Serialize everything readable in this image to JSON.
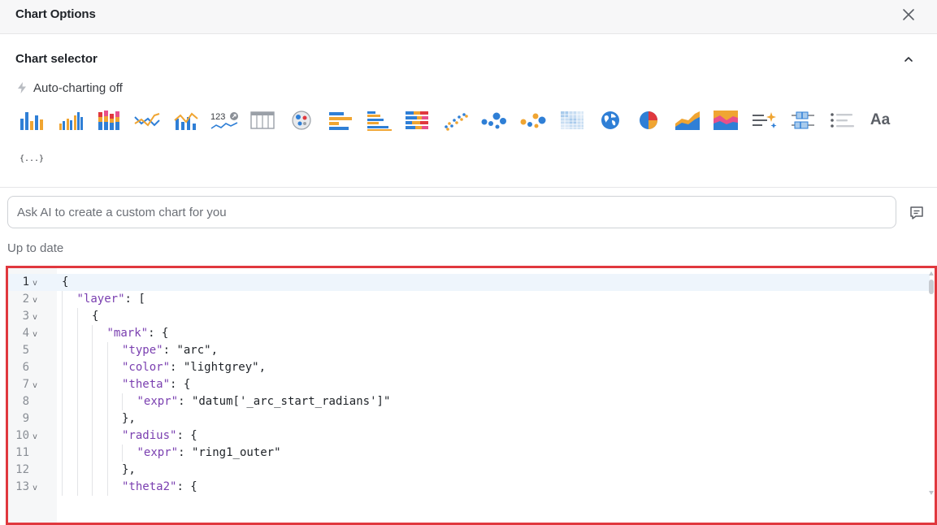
{
  "header": {
    "title": "Chart Options"
  },
  "selector": {
    "title": "Chart selector",
    "auto_label": "Auto-charting off",
    "icons": [
      "bar-chart-icon",
      "grouped-bar-chart-icon",
      "stacked-bar-chart-icon",
      "line-chart-icon",
      "combo-chart-icon",
      "scorecard-icon",
      "table-icon",
      "pivot-chart-icon",
      "horizontal-bar-chart-icon",
      "horizontal-grouped-bar-icon",
      "horizontal-stacked-bar-icon",
      "scatter-plot-icon",
      "bubble-chart-icon",
      "bubble-colored-chart-icon",
      "heatmap-icon",
      "geo-map-icon",
      "pie-chart-icon",
      "area-chart-icon",
      "stacked-area-chart-icon",
      "ai-text-icon",
      "boxplot-icon",
      "list-icon",
      "text-icon"
    ],
    "text_icon_label": "Aa",
    "json_label": "{...}"
  },
  "ai": {
    "placeholder": "Ask AI to create a custom chart for you"
  },
  "status": "Up to date",
  "editor": {
    "lines": [
      {
        "n": "1",
        "fold": true,
        "indent": 0,
        "tokens": [
          [
            "p",
            "{"
          ]
        ]
      },
      {
        "n": "2",
        "fold": true,
        "indent": 1,
        "tokens": [
          [
            "k",
            "\"layer\""
          ],
          [
            "p",
            ": ["
          ]
        ]
      },
      {
        "n": "3",
        "fold": true,
        "indent": 2,
        "tokens": [
          [
            "p",
            "{"
          ]
        ]
      },
      {
        "n": "4",
        "fold": true,
        "indent": 3,
        "tokens": [
          [
            "k",
            "\"mark\""
          ],
          [
            "p",
            ": {"
          ]
        ]
      },
      {
        "n": "5",
        "fold": false,
        "indent": 4,
        "tokens": [
          [
            "k",
            "\"type\""
          ],
          [
            "p",
            ": "
          ],
          [
            "s",
            "\"arc\""
          ],
          [
            "p",
            ","
          ]
        ]
      },
      {
        "n": "6",
        "fold": false,
        "indent": 4,
        "tokens": [
          [
            "k",
            "\"color\""
          ],
          [
            "p",
            ": "
          ],
          [
            "s",
            "\"lightgrey\""
          ],
          [
            "p",
            ","
          ]
        ]
      },
      {
        "n": "7",
        "fold": true,
        "indent": 4,
        "tokens": [
          [
            "k",
            "\"theta\""
          ],
          [
            "p",
            ": {"
          ]
        ]
      },
      {
        "n": "8",
        "fold": false,
        "indent": 5,
        "tokens": [
          [
            "k",
            "\"expr\""
          ],
          [
            "p",
            ": "
          ],
          [
            "s",
            "\"datum['_arc_start_radians']\""
          ]
        ]
      },
      {
        "n": "9",
        "fold": false,
        "indent": 4,
        "tokens": [
          [
            "p",
            "},"
          ]
        ]
      },
      {
        "n": "10",
        "fold": true,
        "indent": 4,
        "tokens": [
          [
            "k",
            "\"radius\""
          ],
          [
            "p",
            ": {"
          ]
        ]
      },
      {
        "n": "11",
        "fold": false,
        "indent": 5,
        "tokens": [
          [
            "k",
            "\"expr\""
          ],
          [
            "p",
            ": "
          ],
          [
            "s",
            "\"ring1_outer\""
          ]
        ]
      },
      {
        "n": "12",
        "fold": false,
        "indent": 4,
        "tokens": [
          [
            "p",
            "},"
          ]
        ]
      },
      {
        "n": "13",
        "fold": true,
        "indent": 4,
        "tokens": [
          [
            "k",
            "\"theta2\""
          ],
          [
            "p",
            ": {"
          ]
        ]
      }
    ]
  },
  "colors": {
    "blue": "#2f7fd6",
    "orange": "#f0a532",
    "red": "#e0383e",
    "pink": "#e8508a",
    "key_purple": "#7a3fb0"
  }
}
